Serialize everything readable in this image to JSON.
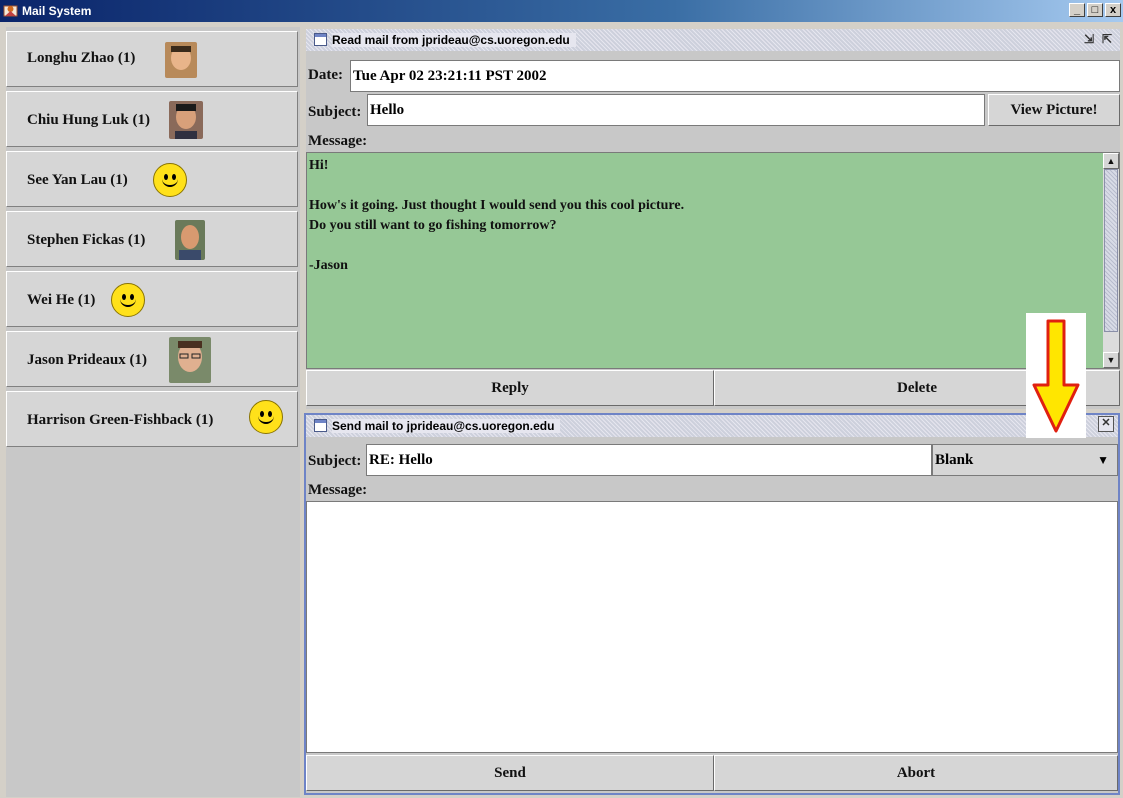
{
  "window": {
    "title": "Mail System"
  },
  "contacts": [
    {
      "label": "Longhu Zhao (1)",
      "avatar": "photo-icon"
    },
    {
      "label": "Chiu Hung Luk (1)",
      "avatar": "photo-icon"
    },
    {
      "label": "See Yan Lau (1)",
      "avatar": "smiley-icon"
    },
    {
      "label": "Stephen Fickas (1)",
      "avatar": "photo-icon"
    },
    {
      "label": "Wei He (1)",
      "avatar": "smiley-icon"
    },
    {
      "label": "Jason Prideaux (1)",
      "avatar": "photo-icon"
    },
    {
      "label": "Harrison Green-Fishback (1)",
      "avatar": "smiley-icon"
    }
  ],
  "read": {
    "title": "Read mail from jprideau@cs.uoregon.edu",
    "date_label": "Date:",
    "date_value": "Tue Apr 02 23:21:11 PST 2002",
    "subject_label": "Subject:",
    "subject_value": "Hello",
    "view_picture": "View Picture!",
    "message_label": "Message:",
    "lines": [
      "Hi!",
      "",
      "How's it going. Just thought I would send you this cool picture.",
      "Do you still want to go fishing tomorrow?",
      "",
      "-Jason"
    ],
    "reply": "Reply",
    "delete": "Delete",
    "message_bg": "#96c896"
  },
  "send": {
    "title": "Send mail to jprideau@cs.uoregon.edu",
    "subject_label": "Subject:",
    "subject_value": "RE: Hello",
    "template_selected": "Blank",
    "message_label": "Message:",
    "message_value": "",
    "send": "Send",
    "abort": "Abort"
  },
  "colors": {
    "arrow_fill": "#ffe600",
    "arrow_stroke": "#e02010",
    "accent": "#6f84c6"
  }
}
